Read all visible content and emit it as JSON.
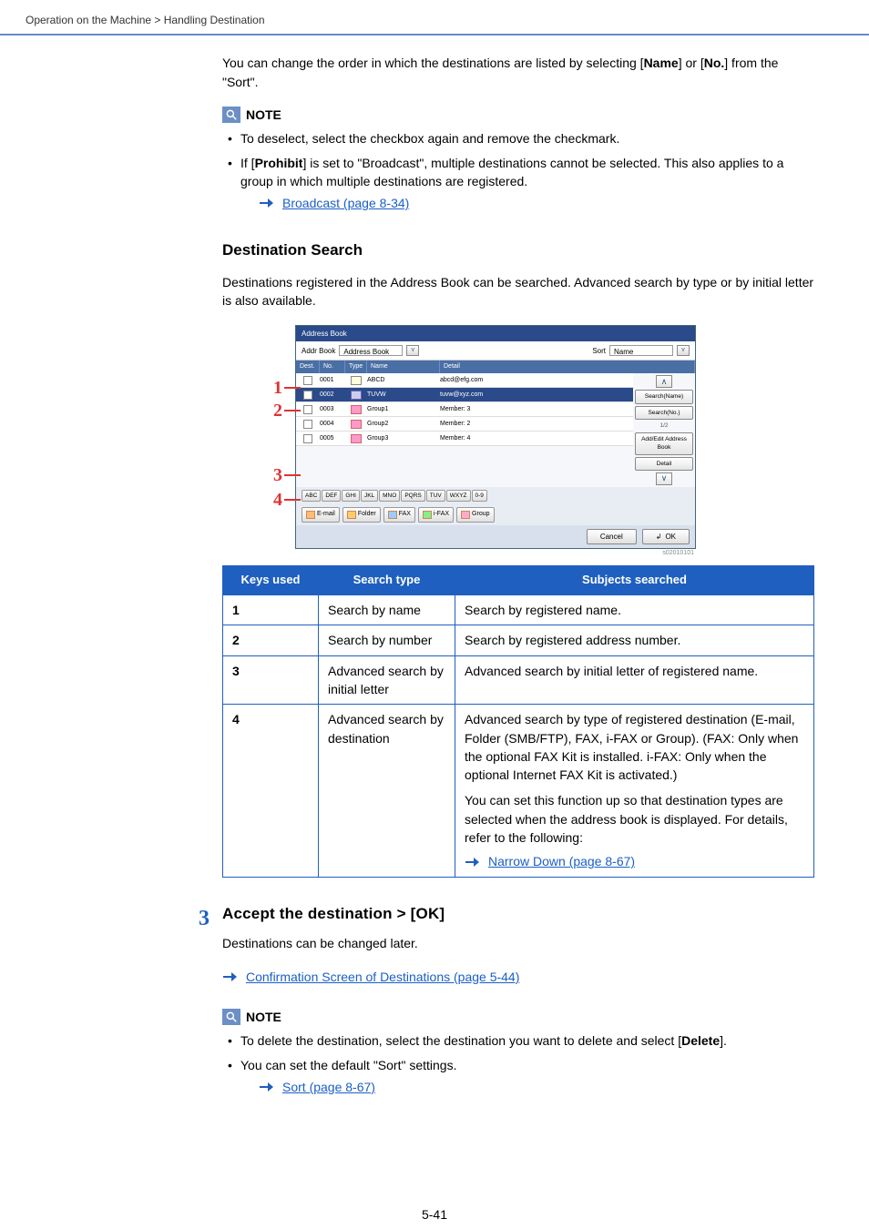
{
  "header": {
    "breadcrumb": "Operation on the Machine > Handling Destination"
  },
  "intro": {
    "text_a": "You can change the order in which the destinations are listed by selecting [",
    "name_b": "Name",
    "text_b": "] or [",
    "no_b": "No.",
    "text_c": "] from the \"Sort\"."
  },
  "note1": {
    "label": "NOTE",
    "b1": "To deselect, select the checkbox again and remove the checkmark.",
    "b2a": "If [",
    "b2b": "Prohibit",
    "b2c": "] is set to \"Broadcast\", multiple destinations cannot be selected. This also applies to a group in which multiple destinations are registered.",
    "link": "Broadcast (page 8-34)"
  },
  "destsearch": {
    "heading": "Destination Search",
    "para": "Destinations registered in the Address Book can be searched. Advanced search by type or by initial letter is also available."
  },
  "screenshot": {
    "title": "Address Book",
    "addr_label": "Addr Book",
    "addr_field": "Address Book",
    "sort_label": "Sort",
    "sort_field": "Name",
    "head_dest": "Dest.",
    "head_no": "No.",
    "head_type": "Type",
    "head_name": "Name",
    "head_detail": "Detail",
    "rows": [
      {
        "no": "0001",
        "name": "ABCD",
        "detail": "abcd@efg.com",
        "type": "mail"
      },
      {
        "no": "0002",
        "name": "TUVW",
        "detail": "tuvw@xyz.com",
        "type": "smb",
        "sel": true
      },
      {
        "no": "0003",
        "name": "Group1",
        "detail": "Member:    3",
        "type": "grp"
      },
      {
        "no": "0004",
        "name": "Group2",
        "detail": "Member:    2",
        "type": "grp"
      },
      {
        "no": "0005",
        "name": "Group3",
        "detail": "Member:    4",
        "type": "grp"
      }
    ],
    "side_search_name": "Search(Name)",
    "side_search_no": "Search(No.)",
    "page": "1/2",
    "side_edit": "Add/Edit Address Book",
    "side_detail": "Detail",
    "alpha": [
      "ABC",
      "DEF",
      "GHI",
      "JKL",
      "MNO",
      "PQRS",
      "TUV",
      "WXYZ",
      "0-9"
    ],
    "filters": {
      "email": "E-mail",
      "folder": "Folder",
      "fax": "FAX",
      "ifax": "i-FAX",
      "group": "Group"
    },
    "cancel": "Cancel",
    "ok": "OK",
    "stamp": "s02010101",
    "callouts": {
      "1": "1",
      "2": "2",
      "3": "3",
      "4": "4"
    }
  },
  "table": {
    "h1": "Keys used",
    "h2": "Search type",
    "h3": "Subjects searched",
    "r1": {
      "k": "1",
      "st": "Search by name",
      "ss": "Search by registered name."
    },
    "r2": {
      "k": "2",
      "st": "Search by number",
      "ss": "Search by registered address number."
    },
    "r3": {
      "k": "3",
      "st": "Advanced search by initial letter",
      "ss": "Advanced search by initial letter of registered name."
    },
    "r4": {
      "k": "4",
      "st": "Advanced search by destination",
      "p1": "Advanced search by type of registered destination (E-mail, Folder (SMB/FTP), FAX, i-FAX or Group). (FAX: Only when the optional FAX Kit is installed. i-FAX: Only when the optional Internet FAX Kit is activated.)",
      "p2": "You can set this function up so that destination types are selected when the address book is displayed. For details, refer to the following:",
      "link": "Narrow Down (page 8-67)"
    }
  },
  "step3": {
    "num": "3",
    "title": "Accept the destination > [OK]",
    "para": "Destinations can be changed later.",
    "link": "Confirmation Screen of Destinations (page 5-44)"
  },
  "note2": {
    "label": "NOTE",
    "b1a": "To delete the destination, select the destination you want to delete and select [",
    "b1b": "Delete",
    "b1c": "].",
    "b2": "You can set the default \"Sort\" settings.",
    "link": "Sort (page 8-67)"
  },
  "pagenum": "5-41"
}
